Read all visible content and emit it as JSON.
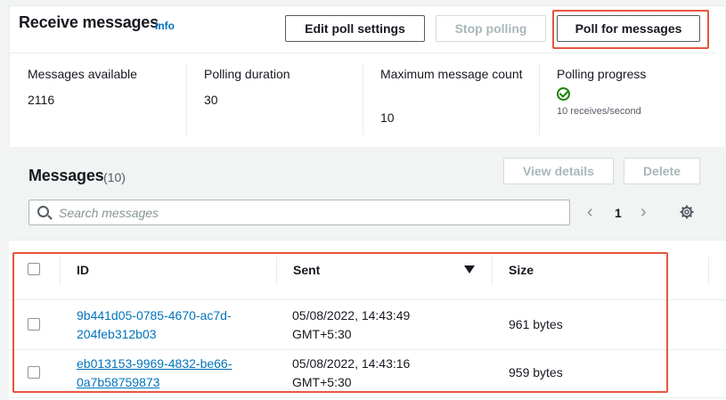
{
  "header": {
    "title": "Receive messages",
    "info_label": "Info",
    "buttons": {
      "edit": "Edit poll settings",
      "stop": "Stop polling",
      "poll": "Poll for messages"
    }
  },
  "stats": [
    {
      "label": "Messages available",
      "value": "2116"
    },
    {
      "label": "Polling duration",
      "value": "30"
    },
    {
      "label": "Maximum message count",
      "value": "10"
    },
    {
      "label": "Polling progress",
      "value": "10 receives/second"
    }
  ],
  "messages": {
    "title": "Messages",
    "count": "(10)",
    "view_details": "View details",
    "delete": "Delete",
    "search_placeholder": "Search messages",
    "page": "1"
  },
  "table": {
    "columns": [
      "ID",
      "Sent",
      "Size"
    ],
    "rows": [
      {
        "id_line1": "9b441d05-0785-4670-ac7d-",
        "id_line2": "204feb312b03",
        "sent_line1": "05/08/2022, 14:43:49",
        "sent_line2": "GMT+5:30",
        "size": "961 bytes"
      },
      {
        "id_line1": "eb013153-9969-4832-be66-",
        "id_line2": "0a7b58759873",
        "sent_line1": "05/08/2022, 14:43:16",
        "sent_line2": "GMT+5:30",
        "size": "959 bytes"
      }
    ]
  },
  "colors": {
    "accent": "#0073bb",
    "highlight": "#e5573f",
    "success": "#1d8102"
  }
}
